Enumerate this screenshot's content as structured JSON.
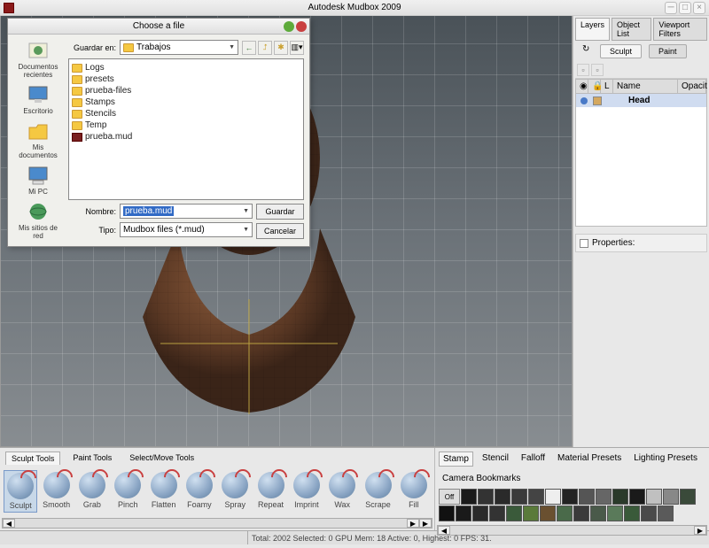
{
  "app": {
    "title": "Autodesk Mudbox 2009"
  },
  "rightpanel": {
    "tabs": [
      "Layers",
      "Object List",
      "Viewport Filters"
    ],
    "subtabs": [
      "Sculpt",
      "Paint"
    ],
    "cols": {
      "name": "Name",
      "opacity": "Opacit"
    },
    "layer": "Head",
    "properties": "Properties:"
  },
  "tools": {
    "tabs": [
      "Sculpt Tools",
      "Paint Tools",
      "Select/Move Tools"
    ],
    "items": [
      "Sculpt",
      "Smooth",
      "Grab",
      "Pinch",
      "Flatten",
      "Foamy",
      "Spray",
      "Repeat",
      "Imprint",
      "Wax",
      "Scrape",
      "Fill"
    ]
  },
  "stamps": {
    "tabs": [
      "Stamp",
      "Stencil",
      "Falloff",
      "Material Presets",
      "Lighting Presets",
      "Camera Bookmarks"
    ],
    "off": "Off"
  },
  "status": "Total: 2002  Selected: 0 GPU Mem: 18  Active: 0, Highest: 0  FPS: 31.",
  "dialog": {
    "title": "Choose a file",
    "save_in_label": "Guardar en:",
    "save_in_value": "Trabajos",
    "files": [
      "Logs",
      "presets",
      "prueba-files",
      "Stamps",
      "Stencils",
      "Temp"
    ],
    "mudfile": "prueba.mud",
    "name_label": "Nombre:",
    "name_value": "prueba.mud",
    "type_label": "Tipo:",
    "type_value": "Mudbox files (*.mud)",
    "save": "Guardar",
    "cancel": "Cancelar",
    "places": [
      "Documentos recientes",
      "Escritorio",
      "Mis documentos",
      "Mi PC",
      "Mis sitios de red"
    ]
  }
}
